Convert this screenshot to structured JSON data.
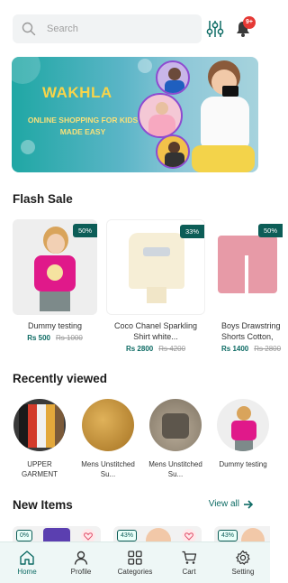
{
  "search": {
    "placeholder": "Search"
  },
  "notifications": {
    "badge": "9+"
  },
  "banner": {
    "title": "WAKHLA",
    "subtitle": "ONLINE SHOPPING FOR KIDS MADE EASY"
  },
  "flash_sale": {
    "title": "Flash Sale",
    "items": [
      {
        "name": "Dummy testing",
        "price": "Rs 500",
        "old_price": "Rs 1000",
        "discount": "50%"
      },
      {
        "name": "Coco Chanel Sparkling Shirt white...",
        "price": "Rs 2800",
        "old_price": "Rs 4200",
        "discount": "33%"
      },
      {
        "name": "Boys Drawstring Shorts Cotton, Bol",
        "price": "Rs 1400",
        "old_price": "Rs 2800",
        "discount": "50%"
      }
    ]
  },
  "recently_viewed": {
    "title": "Recently viewed",
    "items": [
      {
        "label": "UPPER GARMENT"
      },
      {
        "label": "Mens Unstitched Su..."
      },
      {
        "label": "Mens Unstitched Su..."
      },
      {
        "label": "Dummy testing"
      }
    ]
  },
  "new_items": {
    "title": "New Items",
    "view_all": "View all",
    "items": [
      {
        "discount": "0%"
      },
      {
        "discount": "43%"
      },
      {
        "discount": "43%"
      }
    ]
  },
  "nav": {
    "items": [
      {
        "label": "Home",
        "icon": "home-icon"
      },
      {
        "label": "Profile",
        "icon": "user-icon"
      },
      {
        "label": "Categories",
        "icon": "grid-icon"
      },
      {
        "label": "Cart",
        "icon": "cart-icon"
      },
      {
        "label": "Setting",
        "icon": "gear-icon"
      }
    ],
    "active": "Home"
  },
  "colors": {
    "accent": "#0d6b64",
    "badge": "#e53935",
    "banner_title": "#f7d44a"
  }
}
